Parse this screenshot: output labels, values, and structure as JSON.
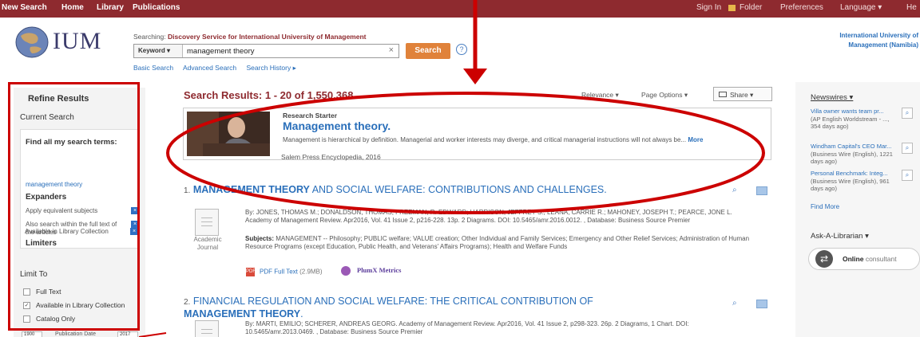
{
  "topnav": {
    "left": [
      "New Search",
      "Home",
      "Library",
      "Publications"
    ],
    "right": [
      "Sign In",
      "Folder",
      "Preferences",
      "Language ▾",
      "He"
    ]
  },
  "header": {
    "logo_text": "IUM",
    "searching_prefix": "Searching:",
    "searching_target": "Discovery Service for International University of Management",
    "search_field": "Keyword ▾",
    "query": "management theory",
    "search_button": "Search",
    "help": "?",
    "sublinks": [
      "Basic Search",
      "Advanced Search",
      "Search History ▸"
    ],
    "institution_line1": "International University of",
    "institution_line2": "Management (Namibia)"
  },
  "refine": {
    "title": "Refine Results",
    "current_search": "Current Search",
    "find_all": "Find all my search terms:",
    "term": "management theory",
    "expanders": "Expanders",
    "expander1": "Apply equivalent subjects",
    "expander2": "Also search within the full text of the articles",
    "limiters": "Limiters",
    "limiter1": "Available in Library Collection",
    "limit_to": "Limit To",
    "checkboxes": [
      "Full Text",
      "Available in Library Collection",
      "Catalog Only"
    ],
    "pub_date_label": "Publication Date",
    "year_from": "1900",
    "year_to": "2017"
  },
  "results": {
    "header": "Search Results: 1 - 20 of 1,550,368",
    "relevance": "Relevance ▾",
    "page_options": "Page Options ▾",
    "share": "Share ▾"
  },
  "starter": {
    "label": "Research Starter",
    "title": "Management theory.",
    "description": "Management is hierarchical by definition. Managerial and worker interests may diverge, and critical managerial instructions will not always be...",
    "more": "More",
    "source": "Salem Press Encyclopedia, 2016"
  },
  "items": [
    {
      "num": "1.",
      "title_bold": "MANAGEMENT THEORY",
      "title_rest": " AND SOCIAL WELFARE: CONTRIBUTIONS AND CHALLENGES.",
      "byline": "By: JONES, THOMAS M.; DONALDSON, THOMAS; FREEMAN, R. EDWARD; HARRISON, JEFFREY S.; LEANA, CARRIE R.; MAHONEY, JOSEPH T.; PEARCE, JONE L. Academy of Management Review. Apr2016, Vol. 41 Issue 2, p216-228. 13p. 2 Diagrams. DOI: 10.5465/amr.2016.0012. , Database: Business Source Premier",
      "subjects_label": "Subjects:",
      "subjects": " MANAGEMENT -- Philosophy; PUBLIC welfare; VALUE creation; Other Individual and Family Services; Emergency and Other Relief Services; Administration of Human Resource Programs (except Education, Public Health, and Veterans' Affairs Programs); Health and Welfare Funds",
      "type": "Academic Journal",
      "pdf": "PDF Full Text",
      "pdf_size": "(2.9MB)",
      "plumx": "PlumX Metrics"
    },
    {
      "num": "2.",
      "title_rest": " FINANCIAL REGULATION AND SOCIAL WELFARE: THE CRITICAL CONTRIBUTION OF",
      "title_bold": "MANAGEMENT THEORY",
      "byline": "By: MARTI, EMILIO; SCHERER, ANDREAS GEORG. Academy of Management Review. Apr2016, Vol. 41 Issue 2, p298-323. 26p. 2 Diagrams, 1 Chart. DOI: 10.5465/amr.2013.0469. , Database: Business Source Premier"
    }
  ],
  "right": {
    "newswires": "Newswires ▾",
    "news": [
      {
        "title": "Villa owner wants team pr...",
        "meta": " (AP English Worldstream - ..., 354 days ago)"
      },
      {
        "title": "Windham Capital's CEO Mar...",
        "meta": " (Business Wire (English), 1221 days ago)"
      },
      {
        "title": "Personal Benchmark: Integ...",
        "meta": " (Business Wire (English), 961 days ago)"
      }
    ],
    "find_more": "Find More",
    "ask": "Ask-A-Librarian ▾",
    "online": "Online",
    "consultant": " consultant"
  },
  "colors": {
    "topnav": "#8e2a2f",
    "link": "#2a6fba",
    "search_button": "#e0823a",
    "annotation_red": "#cc0000"
  }
}
